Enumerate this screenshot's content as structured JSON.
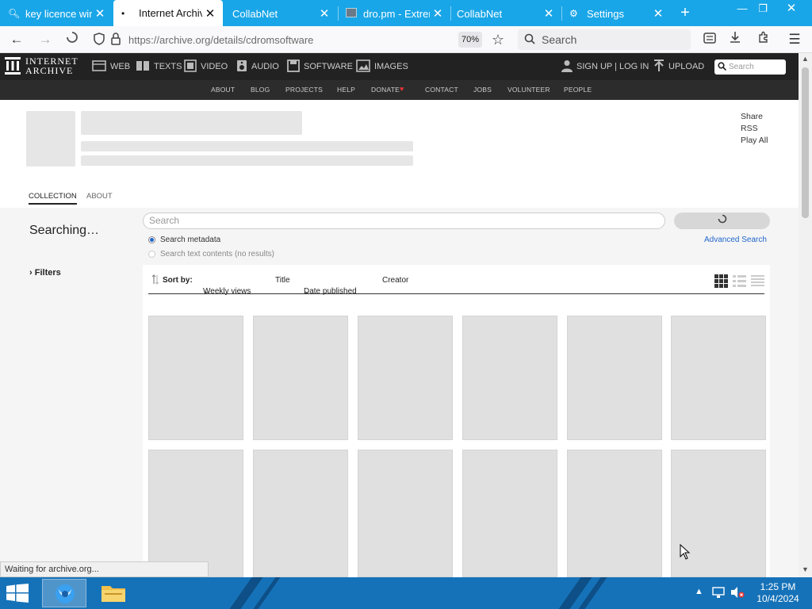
{
  "browser": {
    "tabs": [
      {
        "title": "key licence wir",
        "icon": "search-icon",
        "active": false
      },
      {
        "title": "Internet Archiv",
        "icon": "loading-dot-icon",
        "active": true
      },
      {
        "title": "CollabNet",
        "icon": "",
        "active": false
      },
      {
        "title": "dro.pm - Extrem",
        "icon": "page-icon",
        "active": false
      },
      {
        "title": "CollabNet",
        "icon": "",
        "active": false
      },
      {
        "title": "Settings",
        "icon": "gear-icon",
        "active": false
      }
    ],
    "url": "https://archive.org/details/cdromsoftware",
    "zoom": "70%",
    "search_placeholder": "Search"
  },
  "ia": {
    "logo_line1": "INTERNET",
    "logo_line2": "ARCHIVE",
    "nav": [
      {
        "label": "WEB",
        "icon": "web-icon"
      },
      {
        "label": "TEXTS",
        "icon": "book-icon"
      },
      {
        "label": "VIDEO",
        "icon": "film-icon"
      },
      {
        "label": "AUDIO",
        "icon": "speaker-icon"
      },
      {
        "label": "SOFTWARE",
        "icon": "floppy-icon"
      },
      {
        "label": "IMAGES",
        "icon": "image-icon"
      }
    ],
    "signup": "SIGN UP | LOG IN",
    "upload": "UPLOAD",
    "search_placeholder": "Search",
    "subnav": [
      "ABOUT",
      "BLOG",
      "PROJECTS",
      "HELP",
      "DONATE",
      "CONTACT",
      "JOBS",
      "VOLUNTEER",
      "PEOPLE"
    ]
  },
  "collection": {
    "side_links": [
      "Share",
      "RSS",
      "Play All"
    ],
    "tabs": [
      "COLLECTION",
      "ABOUT"
    ],
    "status": "Searching…",
    "filters_label": "Filters",
    "search_placeholder": "Search",
    "radio_metadata": "Search metadata",
    "radio_text": "Search text contents (no results)",
    "advanced_search": "Advanced Search",
    "sort_by": "Sort by:",
    "sort_options": [
      "Weekly views",
      "Title",
      "Date published",
      "Creator"
    ]
  },
  "statusbar": "Waiting for archive.org...",
  "taskbar": {
    "time": "1:25 PM",
    "date": "10/4/2024"
  },
  "colors": {
    "tab_strip": "#19a6e8",
    "ia_bar": "#222222",
    "taskbar": "#1672b8",
    "link": "#2266cc"
  }
}
